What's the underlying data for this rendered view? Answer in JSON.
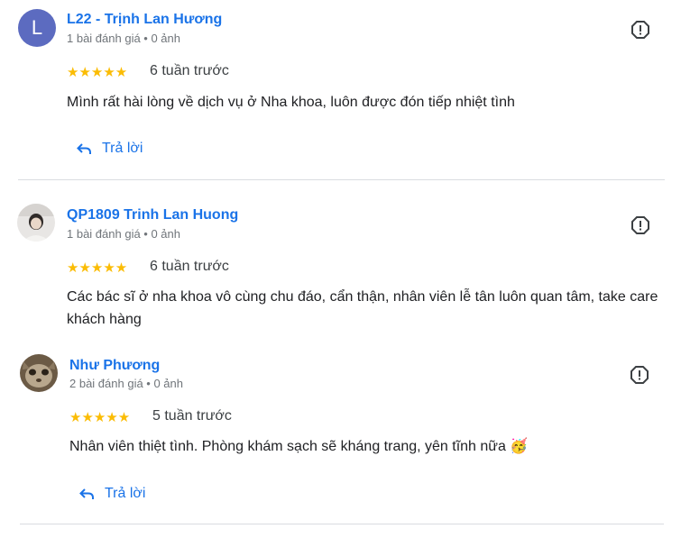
{
  "reviews": [
    {
      "author": "L22 - Trịnh Lan Hương",
      "avatar_letter": "L",
      "meta": "1 bài đánh giá • 0 ảnh",
      "stars": "★★★★★",
      "rating": 5,
      "time": "6 tuần trước",
      "text": "Mình rất hài lòng về dịch vụ ở Nha khoa, luôn được đón tiếp nhiệt tình",
      "reply_label": "Trả lời"
    },
    {
      "author": "QP1809 Trinh Lan Huong",
      "meta": "1 bài đánh giá • 0 ảnh",
      "stars": "★★★★★",
      "rating": 5,
      "time": "6 tuần trước",
      "text": "Các bác sĩ ở nha khoa vô cùng chu đáo, cẩn thận, nhân viên lễ tân luôn quan tâm, take care khách hàng"
    },
    {
      "author": "Như Phương",
      "meta": "2 bài đánh giá • 0 ảnh",
      "stars": "★★★★★",
      "rating": 5,
      "time": "5 tuần trước",
      "text": "Nhân viên thiệt tình. Phòng khám sạch sẽ kháng trang, yên tĩnh nữa 🥳",
      "reply_label": "Trả lời"
    }
  ],
  "colors": {
    "link": "#1a73e8",
    "star": "#fbbc04",
    "avatar_letter_bg": "#5c6bc0",
    "divider": "#dadce0"
  },
  "icons": {
    "flag": "report-flag-icon",
    "reply": "reply-arrow-icon"
  }
}
